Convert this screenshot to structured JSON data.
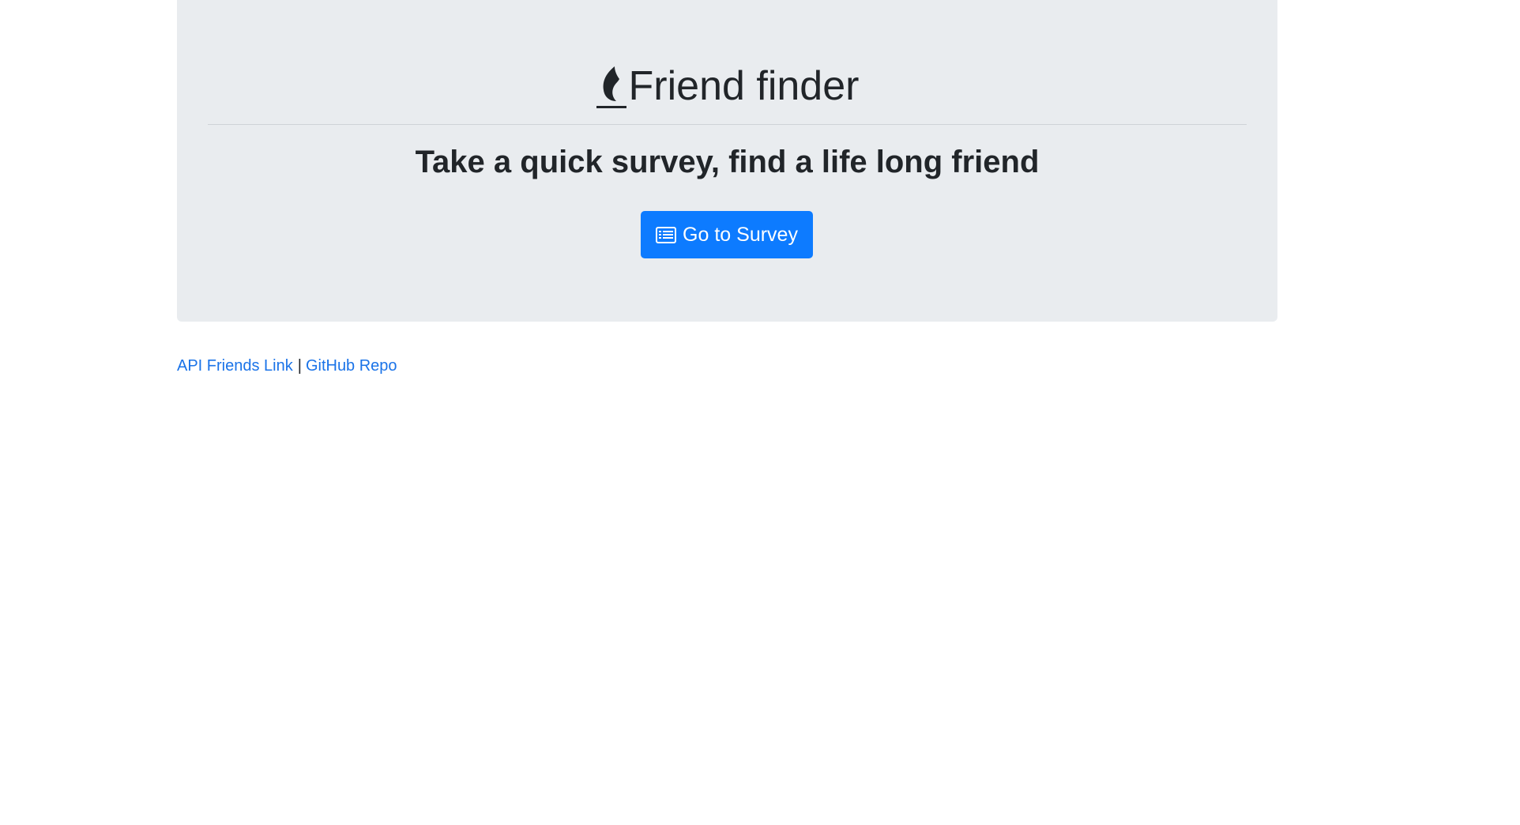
{
  "header": {
    "icon": "flame-icon",
    "title": "Friend finder",
    "tagline": "Take a quick survey, find a life long friend"
  },
  "cta": {
    "icon": "list-alt-icon",
    "label": "Go to Survey",
    "background": "#0d7bff"
  },
  "footer": {
    "api_link": "API Friends Link",
    "separator": "|",
    "github_link": "GitHub Repo",
    "link_color": "#1a73e8"
  },
  "colors": {
    "jumbotron": "#e9ecef",
    "text": "#212529"
  }
}
